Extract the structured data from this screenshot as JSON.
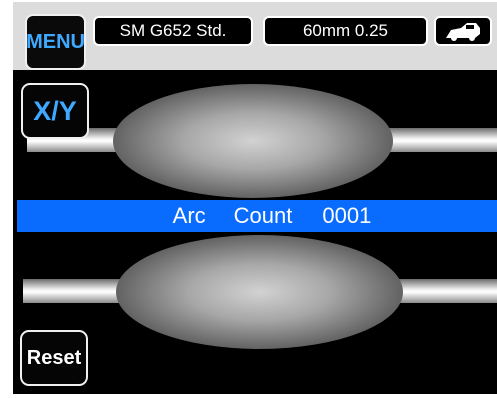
{
  "header": {
    "menu_label": "MENU",
    "fiber_profile": "SM G652 Std.",
    "fiber_setting": "60mm 0.25"
  },
  "buttons": {
    "xy_label": "X/Y",
    "reset_label": "Reset"
  },
  "arc_count": {
    "label_1": "Arc",
    "label_2": "Count",
    "value": "0001"
  },
  "icons": {
    "status_icon": "device-icon"
  },
  "colors": {
    "accent_blue": "#0a6cff",
    "button_text_blue": "#3fa9ff",
    "screen_bg": "#000000",
    "topbar_bg": "#dcdcdc"
  }
}
